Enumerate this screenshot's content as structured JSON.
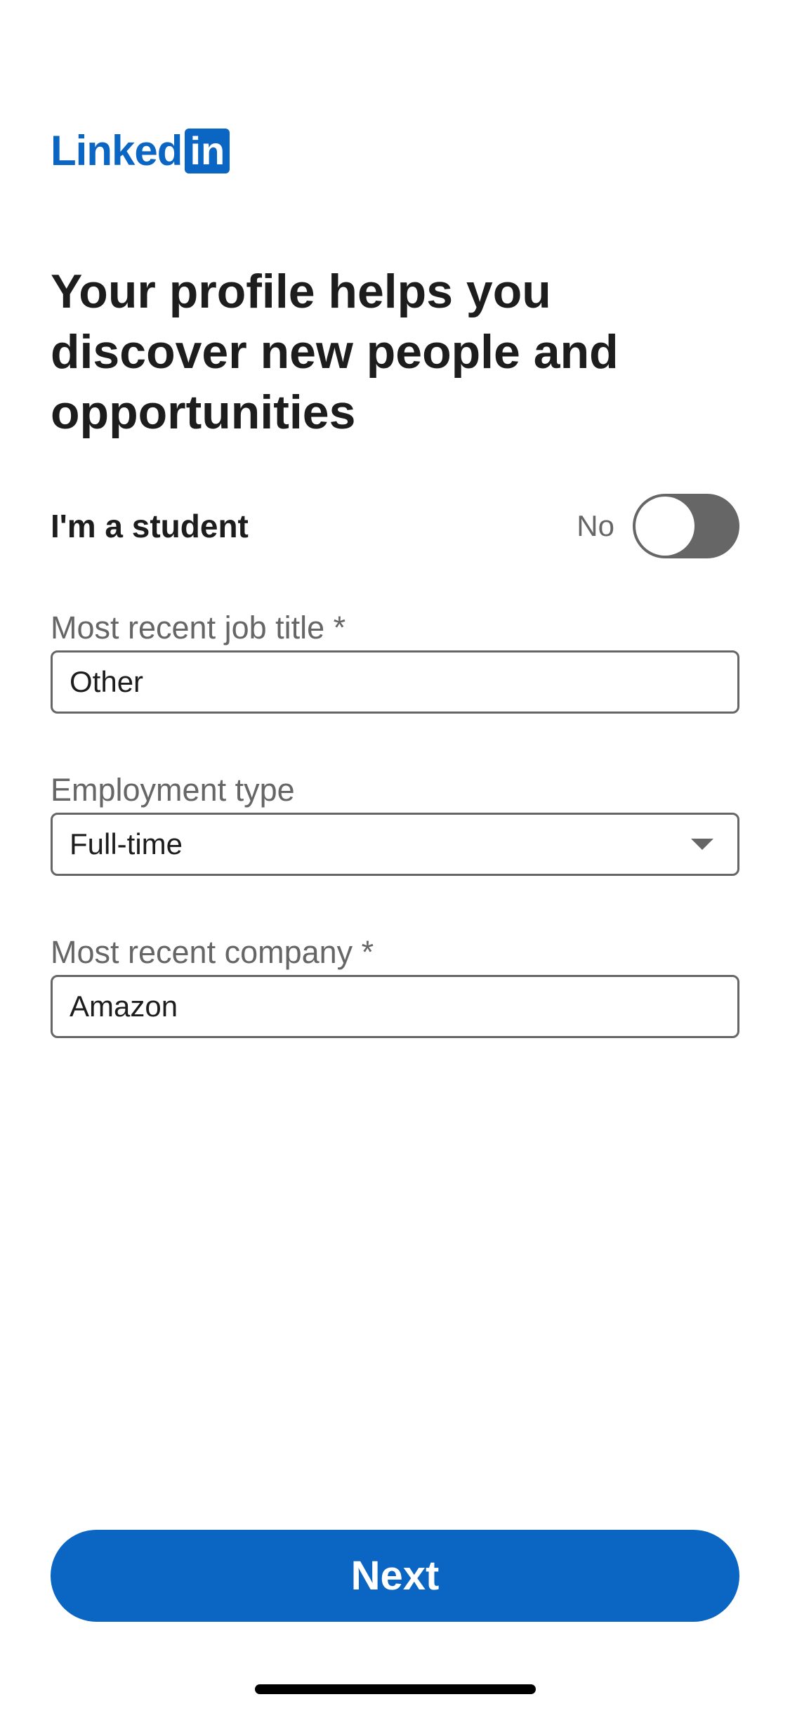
{
  "logo": {
    "word": "Linked",
    "box": "in"
  },
  "headline": "Your profile helps you discover new people and opportunities",
  "student": {
    "label": "I'm a student",
    "state": "No"
  },
  "job_title": {
    "label": "Most recent job title *",
    "value": "Other"
  },
  "employment_type": {
    "label": "Employment type",
    "value": "Full-time"
  },
  "company": {
    "label": "Most recent company *",
    "value": "Amazon"
  },
  "next_button": {
    "label": "Next"
  },
  "colors": {
    "brand": "#0a66c2",
    "toggle_off": "#666666",
    "text": "#1d1d1d"
  }
}
